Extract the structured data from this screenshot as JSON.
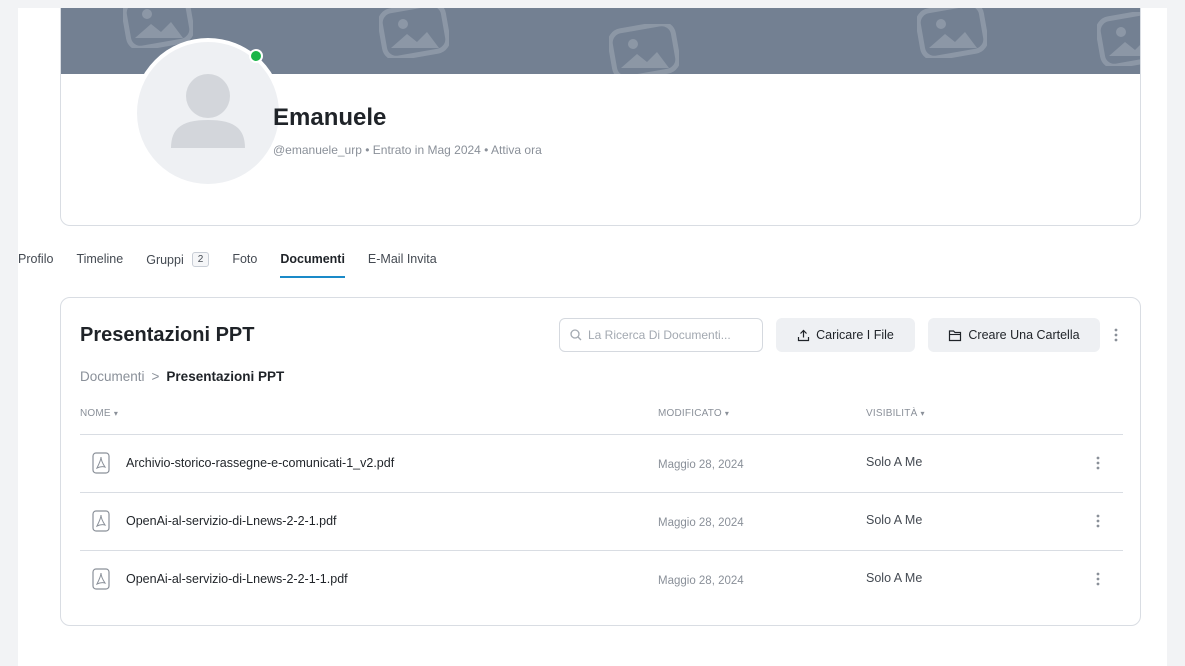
{
  "profile": {
    "name": "Emanuele",
    "meta": "@emanuele_urp • Entrato in Mag 2024 • Attiva ora",
    "online_color": "#19b548"
  },
  "tabs": [
    {
      "label": "Profilo"
    },
    {
      "label": "Timeline"
    },
    {
      "label": "Gruppi",
      "count": "2"
    },
    {
      "label": "Foto"
    },
    {
      "label": "Documenti",
      "active": true
    },
    {
      "label": "E-Mail Invita"
    }
  ],
  "docs": {
    "title": "Presentazioni PPT",
    "search_placeholder": "La Ricerca Di Documenti...",
    "upload_label": "Caricare I File",
    "folder_label": "Creare Una Cartella",
    "breadcrumb": {
      "root": "Documenti",
      "separator": ">",
      "current": "Presentazioni PPT"
    },
    "columns": {
      "name": "NOME",
      "modified": "MODIFICATO",
      "visibility": "VISIBILITÀ",
      "sort_caret": "▾"
    },
    "files": [
      {
        "name": "Archivio-storico-rassegne-e-comunicati-1_v2.pdf",
        "modified": "Maggio 28, 2024",
        "visibility": "Solo A Me"
      },
      {
        "name": "OpenAi-al-servizio-di-Lnews-2-2-1.pdf",
        "modified": "Maggio 28, 2024",
        "visibility": "Solo A Me"
      },
      {
        "name": "OpenAi-al-servizio-di-Lnews-2-2-1-1.pdf",
        "modified": "Maggio 28, 2024",
        "visibility": "Solo A Me"
      }
    ]
  },
  "icons": {
    "search": "search-icon",
    "upload": "upload-icon",
    "folder": "folder-icon",
    "kebab": "kebab-menu-icon",
    "pdf": "pdf-file-icon",
    "chevron": "chevron-right-icon"
  },
  "colors": {
    "cover": "#738092",
    "accent": "#1a8ac8"
  }
}
